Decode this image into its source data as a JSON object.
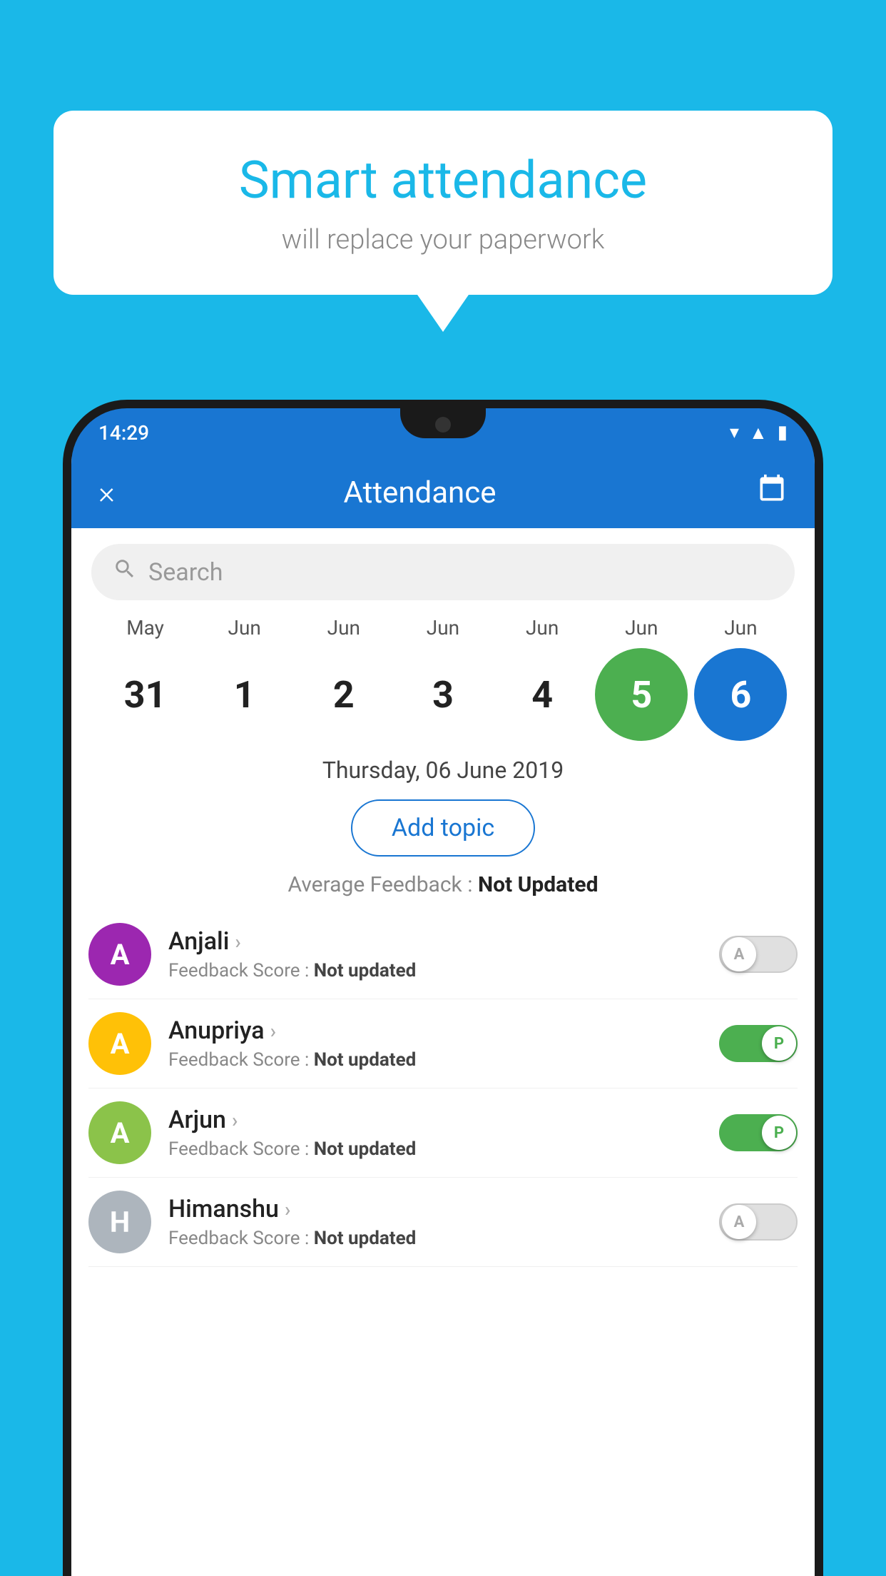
{
  "background_color": "#1ab8e8",
  "speech_bubble": {
    "title": "Smart attendance",
    "subtitle": "will replace your paperwork"
  },
  "status_bar": {
    "time": "14:29",
    "icons": [
      "wifi",
      "signal",
      "battery"
    ]
  },
  "app_bar": {
    "title": "Attendance",
    "close_label": "×",
    "calendar_icon": "📅"
  },
  "search": {
    "placeholder": "Search"
  },
  "calendar": {
    "months": [
      "May",
      "Jun",
      "Jun",
      "Jun",
      "Jun",
      "Jun",
      "Jun"
    ],
    "dates": [
      "31",
      "1",
      "2",
      "3",
      "4",
      "5",
      "6"
    ],
    "today_index": 5,
    "selected_index": 6
  },
  "selected_date_label": "Thursday, 06 June 2019",
  "add_topic_label": "Add topic",
  "avg_feedback_label": "Average Feedback :",
  "avg_feedback_value": "Not Updated",
  "students": [
    {
      "name": "Anjali",
      "avatar_letter": "A",
      "avatar_color": "#9c27b0",
      "feedback_label": "Feedback Score :",
      "feedback_value": "Not updated",
      "toggle_state": "off",
      "toggle_label": "A"
    },
    {
      "name": "Anupriya",
      "avatar_letter": "A",
      "avatar_color": "#ffc107",
      "feedback_label": "Feedback Score :",
      "feedback_value": "Not updated",
      "toggle_state": "on",
      "toggle_label": "P"
    },
    {
      "name": "Arjun",
      "avatar_letter": "A",
      "avatar_color": "#8bc34a",
      "feedback_label": "Feedback Score :",
      "feedback_value": "Not updated",
      "toggle_state": "on",
      "toggle_label": "P"
    },
    {
      "name": "Himanshu",
      "avatar_letter": "H",
      "avatar_color": "#adb5bd",
      "feedback_label": "Feedback Score :",
      "feedback_value": "Not updated",
      "toggle_state": "off",
      "toggle_label": "A"
    }
  ]
}
